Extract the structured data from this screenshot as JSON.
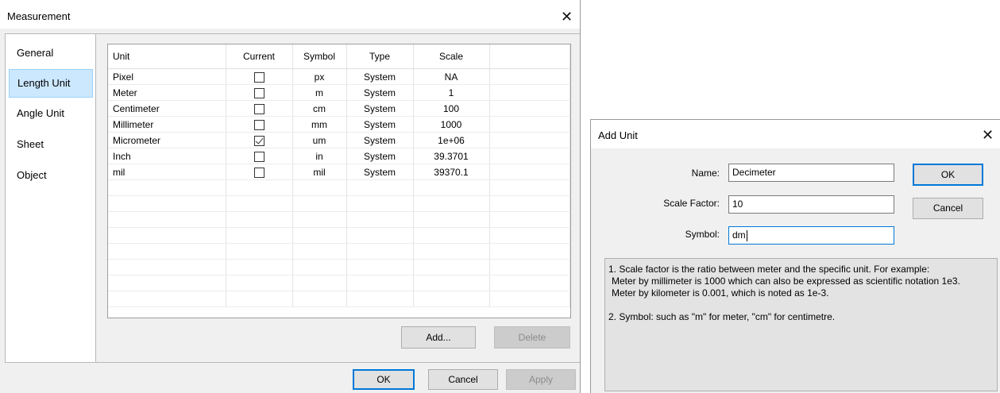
{
  "measurement": {
    "title": "Measurement",
    "sidebar": [
      {
        "label": "General",
        "active": false
      },
      {
        "label": "Length Unit",
        "active": true
      },
      {
        "label": "Angle Unit",
        "active": false
      },
      {
        "label": "Sheet",
        "active": false
      },
      {
        "label": "Object",
        "active": false
      }
    ],
    "table": {
      "columns": [
        "Unit",
        "Current",
        "Symbol",
        "Type",
        "Scale"
      ],
      "rows": [
        {
          "unit": "Pixel",
          "current": false,
          "symbol": "px",
          "type": "System",
          "scale": "NA"
        },
        {
          "unit": "Meter",
          "current": false,
          "symbol": "m",
          "type": "System",
          "scale": "1"
        },
        {
          "unit": "Centimeter",
          "current": false,
          "symbol": "cm",
          "type": "System",
          "scale": "100"
        },
        {
          "unit": "Millimeter",
          "current": false,
          "symbol": "mm",
          "type": "System",
          "scale": "1000"
        },
        {
          "unit": "Micrometer",
          "current": true,
          "symbol": "um",
          "type": "System",
          "scale": "1e+06"
        },
        {
          "unit": "Inch",
          "current": false,
          "symbol": "in",
          "type": "System",
          "scale": "39.3701"
        },
        {
          "unit": "mil",
          "current": false,
          "symbol": "mil",
          "type": "System",
          "scale": "39370.1"
        }
      ]
    },
    "buttons": {
      "add": "Add...",
      "delete": "Delete",
      "ok": "OK",
      "cancel": "Cancel",
      "apply": "Apply"
    }
  },
  "add_unit": {
    "title": "Add Unit",
    "name_label": "Name:",
    "name_value": "Decimeter",
    "scale_label": "Scale Factor:",
    "scale_value": "10",
    "symbol_label": "Symbol:",
    "symbol_value": "dm",
    "ok": "OK",
    "cancel": "Cancel",
    "note_line1": "1. Scale factor is the ratio between meter and the specific unit. For example:",
    "note_line2": "Meter by millimeter is 1000 which can also be expressed as scientific notation 1e3.",
    "note_line3": "Meter by kilometer is 0.001, which is noted as 1e-3.",
    "note_line4": "2. Symbol: such as \"m\" for meter, \"cm\" for centimetre."
  },
  "colors": {
    "selection": "#cce8ff",
    "focus_border": "#0078d7",
    "dialog_bg": "#f0f0f0"
  }
}
